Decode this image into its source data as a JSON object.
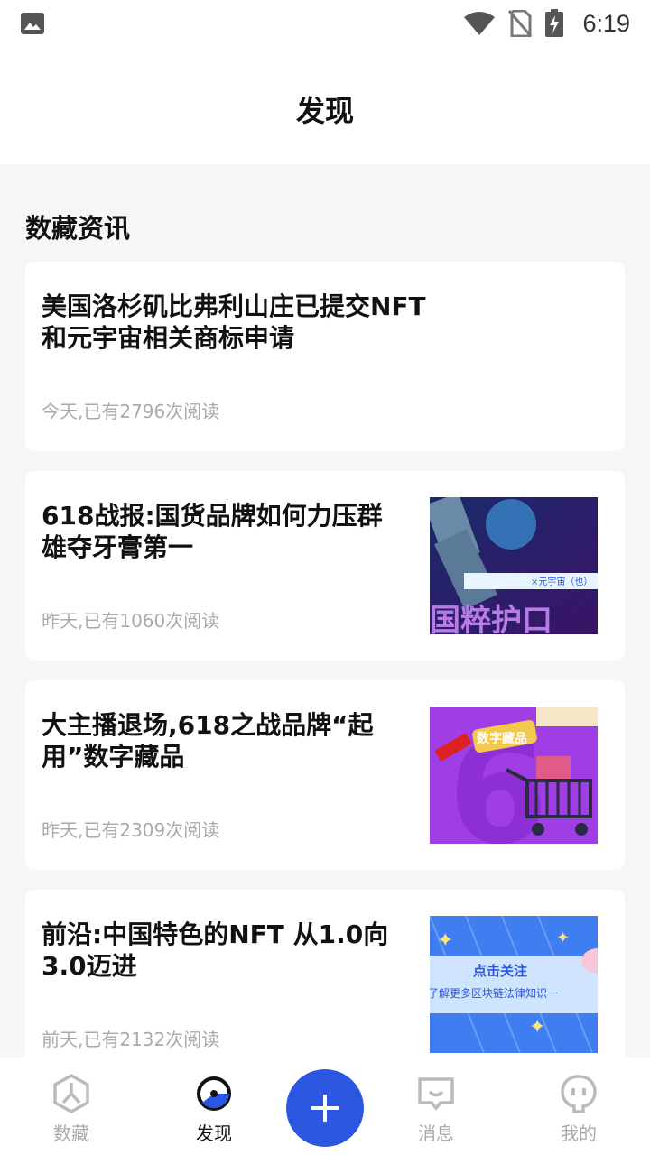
{
  "status_bar": {
    "time": "6:19",
    "icons": [
      "image-icon",
      "wifi-icon",
      "no-sim-icon",
      "battery-charging-icon"
    ]
  },
  "header": {
    "title": "发现"
  },
  "section": {
    "title": "数藏资讯"
  },
  "articles": [
    {
      "title": "美国洛杉矶比弗利山庄已提交NFT和元宇宙相关商标申请",
      "meta": "今天,已有2796次阅读",
      "has_thumb": false
    },
    {
      "title": "618战报:国货品牌如何力压群雄夺牙膏第一",
      "meta": "昨天,已有1060次阅读",
      "has_thumb": true,
      "thumb_texts": [
        "×元宇宙（也）",
        "国粹护口"
      ]
    },
    {
      "title": "大主播退场,618之战品牌“起用”数字藏品",
      "meta": "昨天,已有2309次阅读",
      "has_thumb": true,
      "thumb_texts": [
        "数字藏品",
        "6"
      ]
    },
    {
      "title": "前沿:中国特色的NFT 从1.0向3.0迈进",
      "meta": "前天,已有2132次阅读",
      "has_thumb": true,
      "thumb_texts": [
        "点击关注",
        "了解更多区块链法律知识一"
      ]
    }
  ],
  "tabbar": {
    "tabs": [
      {
        "label": "数藏",
        "icon": "collection-icon",
        "active": false
      },
      {
        "label": "发现",
        "icon": "discover-icon",
        "active": true
      },
      {
        "label": "消息",
        "icon": "message-icon",
        "active": false
      },
      {
        "label": "我的",
        "icon": "profile-icon",
        "active": false
      }
    ],
    "plus_icon": "plus-icon"
  },
  "colors": {
    "accent": "#2b57e0",
    "background": "#f5f6f8",
    "card": "#ffffff",
    "meta_text": "#aaaaaa"
  }
}
